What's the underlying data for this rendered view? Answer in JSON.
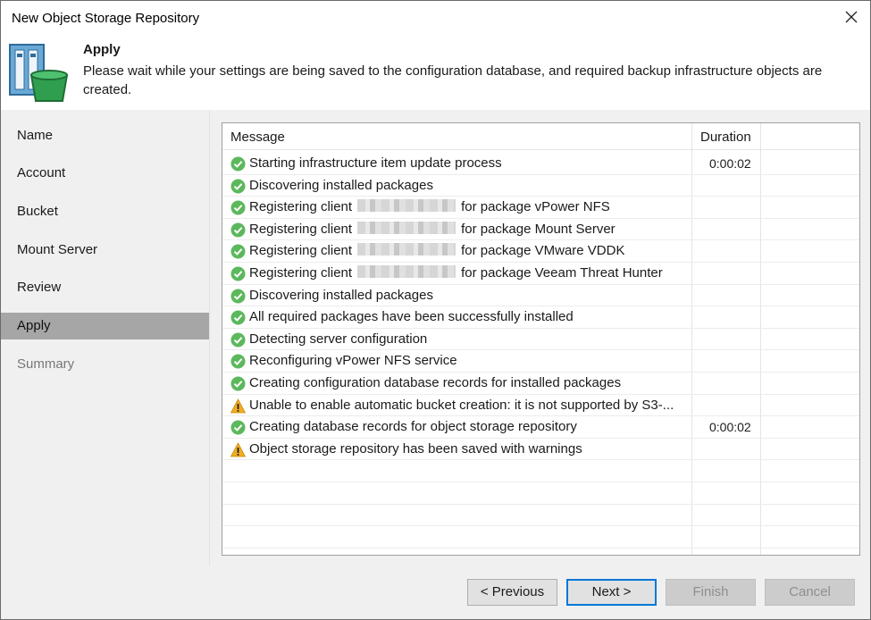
{
  "window": {
    "title": "New Object Storage Repository"
  },
  "header": {
    "title": "Apply",
    "description": "Please wait while your settings are being saved to the configuration database, and required backup infrastructure objects are created."
  },
  "sidebar": {
    "items": [
      {
        "label": "Name",
        "state": "normal"
      },
      {
        "label": "Account",
        "state": "normal"
      },
      {
        "label": "Bucket",
        "state": "normal"
      },
      {
        "label": "Mount Server",
        "state": "normal"
      },
      {
        "label": "Review",
        "state": "normal"
      },
      {
        "label": "Apply",
        "state": "active"
      },
      {
        "label": "Summary",
        "state": "disabled"
      }
    ]
  },
  "grid": {
    "columns": {
      "message": "Message",
      "duration": "Duration"
    },
    "rows": [
      {
        "status": "success",
        "message": "Starting infrastructure item update process",
        "duration": "0:00:02"
      },
      {
        "status": "success",
        "message": "Discovering installed packages",
        "duration": ""
      },
      {
        "status": "success",
        "prefix": "Registering client",
        "redacted": true,
        "suffix": "for package vPower NFS",
        "duration": ""
      },
      {
        "status": "success",
        "prefix": "Registering client",
        "redacted": true,
        "suffix": "for package Mount Server",
        "duration": ""
      },
      {
        "status": "success",
        "prefix": "Registering client",
        "redacted": true,
        "suffix": "for package VMware VDDK",
        "duration": ""
      },
      {
        "status": "success",
        "prefix": "Registering client",
        "redacted": true,
        "suffix": "for package Veeam Threat Hunter",
        "duration": ""
      },
      {
        "status": "success",
        "message": "Discovering installed packages",
        "duration": ""
      },
      {
        "status": "success",
        "message": "All required packages have been successfully installed",
        "duration": ""
      },
      {
        "status": "success",
        "message": "Detecting server configuration",
        "duration": ""
      },
      {
        "status": "success",
        "message": "Reconfiguring vPower NFS service",
        "duration": ""
      },
      {
        "status": "success",
        "message": "Creating configuration database records for installed packages",
        "duration": ""
      },
      {
        "status": "warning",
        "message": "Unable to enable automatic bucket creation: it is not supported by S3-...",
        "duration": ""
      },
      {
        "status": "success",
        "message": "Creating database records for object storage repository",
        "duration": "0:00:02"
      },
      {
        "status": "warning",
        "message": "Object storage repository has been saved with warnings",
        "duration": ""
      }
    ]
  },
  "buttons": {
    "previous": "< Previous",
    "next": "Next >",
    "finish": "Finish",
    "cancel": "Cancel"
  },
  "colors": {
    "success": "#5cb85c",
    "warning": "#f0ad22",
    "active_nav": "#a6a6a6",
    "focus_border": "#0078d7"
  },
  "icons": {
    "close": "close-icon",
    "success": "check-circle-icon",
    "warning": "warning-triangle-icon",
    "header": "object-storage-repository-icon"
  }
}
